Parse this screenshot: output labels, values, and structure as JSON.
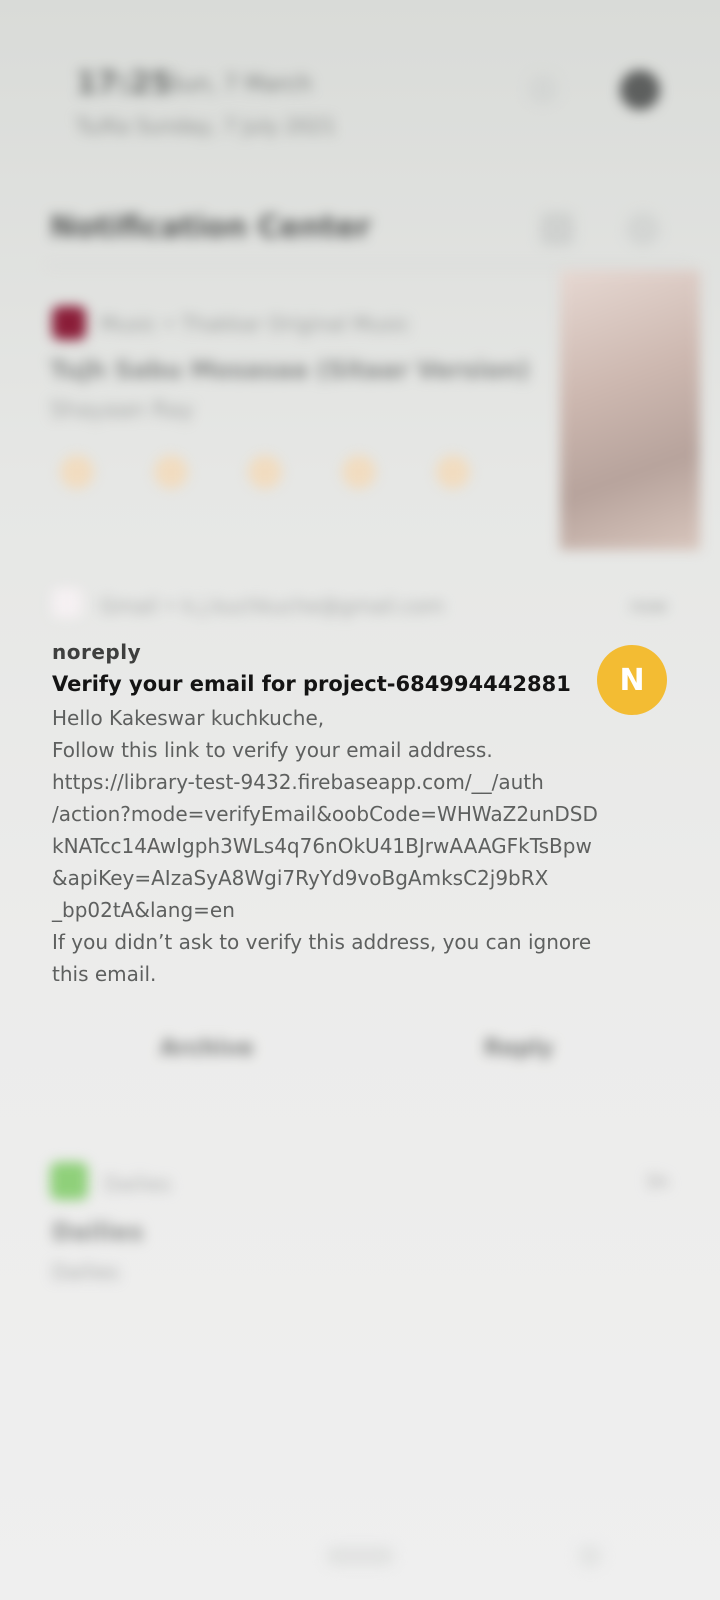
{
  "status": {
    "time": "17:25",
    "date": "Sun, 7 March",
    "subtext": "Tu/Ka Sunday, 7 July 2021"
  },
  "notification_center": {
    "title": "Notification Center"
  },
  "music": {
    "app_line": "Music • Thakkar Original Music",
    "title": "Tujh Sabu Mosasaa (Sitaar Version)",
    "artist": "Shayaan Ray"
  },
  "email": {
    "header": "Gmail • k.j.kuchkuche@gmail.com",
    "time": "now",
    "sender": "noreply",
    "subject": "Verify your email for project-684994442881",
    "body_lines": [
      "Hello Kakeswar kuchkuche,",
      "Follow this link to verify your email address.",
      "https://library-test-9432.firebaseapp.com/__/auth",
      "/action?mode=verifyEmail&oobCode=WHWaZ2unDSD",
      "kNATcc14AwIgph3WLs4q76nOkU41BJrwAAAGFkTsBpw",
      "&apiKey=AIzaSyA8Wgi7RyYd9voBgAmksC2j9bRX",
      "_bp02tA&lang=en",
      "If you didn’t ask to verify this address, you can ignore",
      "this email."
    ],
    "avatar_letter": "N",
    "actions": {
      "archive": "Archive",
      "reply": "Reply"
    }
  },
  "other_notification": {
    "app": "Dailies",
    "time": "5h",
    "title": "Dailies",
    "subtitle": "Dailies"
  },
  "colors": {
    "avatar_badge": "#f3bc33",
    "music_icon": "#8a1d38",
    "other_icon": "#8fd07a"
  }
}
